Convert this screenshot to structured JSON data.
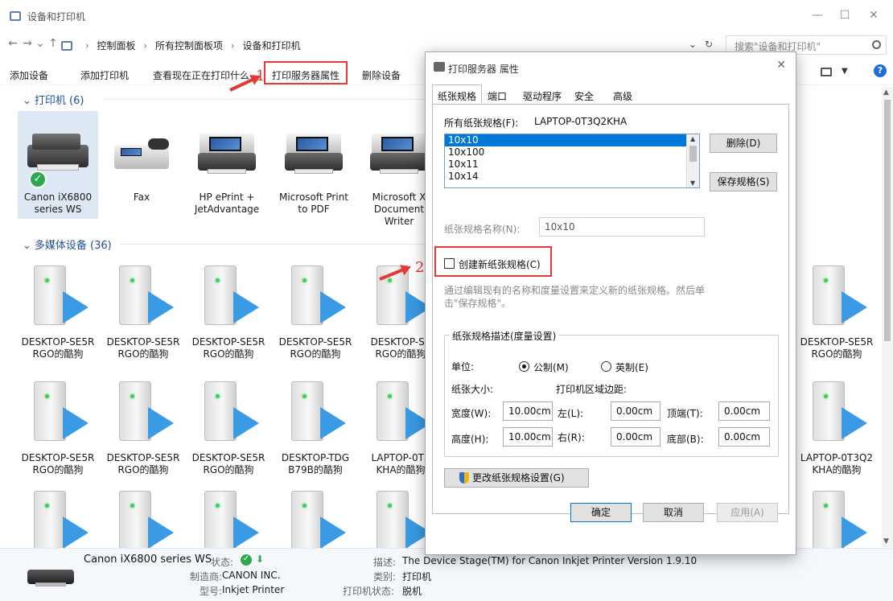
{
  "window": {
    "title": "设备和打印机",
    "min": "—",
    "max": "☐",
    "close": "✕"
  },
  "address": {
    "back": "←",
    "forward": "→",
    "recent": "⌄",
    "up": "↑",
    "crumbs": [
      "控制面板",
      "所有控制面板项",
      "设备和打印机"
    ],
    "sep": "›",
    "dropdown": "⌄",
    "refresh": "↻",
    "search_placeholder": "搜索\"设备和打印机\""
  },
  "toolbar": {
    "add_device": "添加设备",
    "add_printer": "添加打印机",
    "see_printing": "查看现在正在打印什么",
    "print_server": "打印服务器属性",
    "remove_device": "删除设备",
    "view_caret": "▼",
    "help": "?"
  },
  "sections": {
    "printers": "打印机 (6)",
    "media": "多媒体设备 (36)",
    "chevron": "⌄"
  },
  "printers": [
    {
      "l1": "Canon iX6800",
      "l2": "series WS"
    },
    {
      "l1": "Fax",
      "l2": ""
    },
    {
      "l1": "HP ePrint +",
      "l2": "JetAdvantage"
    },
    {
      "l1": "Microsoft Print",
      "l2": "to PDF"
    },
    {
      "l1": "Microsoft X",
      "l2": "Document",
      "l3": "Writer"
    }
  ],
  "media_rows": [
    [
      {
        "l1": "DESKTOP-SE5R",
        "l2": "RGO的酷狗"
      },
      {
        "l1": "DESKTOP-SE5R",
        "l2": "RGO的酷狗"
      },
      {
        "l1": "DESKTOP-SE5R",
        "l2": "RGO的酷狗"
      },
      {
        "l1": "DESKTOP-SE5R",
        "l2": "RGO的酷狗"
      },
      {
        "l1": "DESKTOP-SE",
        "l2": "RGO的酷狗"
      }
    ],
    [
      {
        "l1": "DESKTOP-SE5R",
        "l2": "RGO的酷狗"
      },
      {
        "l1": "DESKTOP-SE5R",
        "l2": "RGO的酷狗"
      },
      {
        "l1": "DESKTOP-SE5R",
        "l2": "RGO的酷狗"
      },
      {
        "l1": "DESKTOP-TDG",
        "l2": "B79B的酷狗"
      },
      {
        "l1": "LAPTOP-0T3",
        "l2": "KHA的酷狗"
      }
    ]
  ],
  "media_right": [
    {
      "l1": "DESKTOP-SE5R",
      "l2": "RGO的酷狗"
    },
    {
      "l1": "LAPTOP-0T3Q2",
      "l2": "KHA的酷狗"
    }
  ],
  "details": {
    "name": "Canon iX6800 series WS",
    "status_lbl": "状态:",
    "maker_lbl": "制造商:",
    "maker": "CANON INC.",
    "model_lbl": "型号:",
    "model": "Inkjet Printer",
    "desc_lbl": "描述:",
    "desc": "The Device Stage(TM) for Canon Inkjet Printer Version 1.9.10",
    "category_lbl": "类别:",
    "category": "打印机",
    "pstatus_lbl": "打印机状态:",
    "pstatus": "脱机"
  },
  "annotations": {
    "one": "1",
    "two": "2"
  },
  "dialog": {
    "title": "打印服务器 属性",
    "close": "✕",
    "tabs": [
      "纸张规格",
      "端口",
      "驱动程序",
      "安全",
      "高级"
    ],
    "all_forms_lbl": "所有纸张规格(F):",
    "server_name": "LAPTOP-0T3Q2KHA",
    "forms": [
      "10x10",
      "10x100",
      "10x11",
      "10x14"
    ],
    "delete_btn": "删除(D)",
    "save_btn": "保存规格(S)",
    "form_name_lbl": "纸张规格名称(N):",
    "form_name_val": "10x10",
    "create_new_lbl": "创建新纸张规格(C)",
    "hint_line1": "通过编辑现有的名称和度量设置来定义新的纸张规格。然后单",
    "hint_line2": "击\"保存规格\"。",
    "group_title": "纸张规格描述(度量设置)",
    "units_lbl": "单位:",
    "metric": "公制(M)",
    "english": "英制(E)",
    "paper_size_lbl": "纸张大小:",
    "margins_lbl": "打印机区域边距:",
    "width_lbl": "宽度(W):",
    "width_val": "10.00cm",
    "height_lbl": "高度(H):",
    "height_val": "10.00cm",
    "left_lbl": "左(L):",
    "left_val": "0.00cm",
    "right_lbl": "右(R):",
    "right_val": "0.00cm",
    "top_lbl": "顶端(T):",
    "top_val": "0.00cm",
    "bottom_lbl": "底部(B):",
    "bottom_val": "0.00cm",
    "change_btn": "更改纸张规格设置(G)",
    "ok": "确定",
    "cancel": "取消",
    "apply": "应用(A)"
  }
}
